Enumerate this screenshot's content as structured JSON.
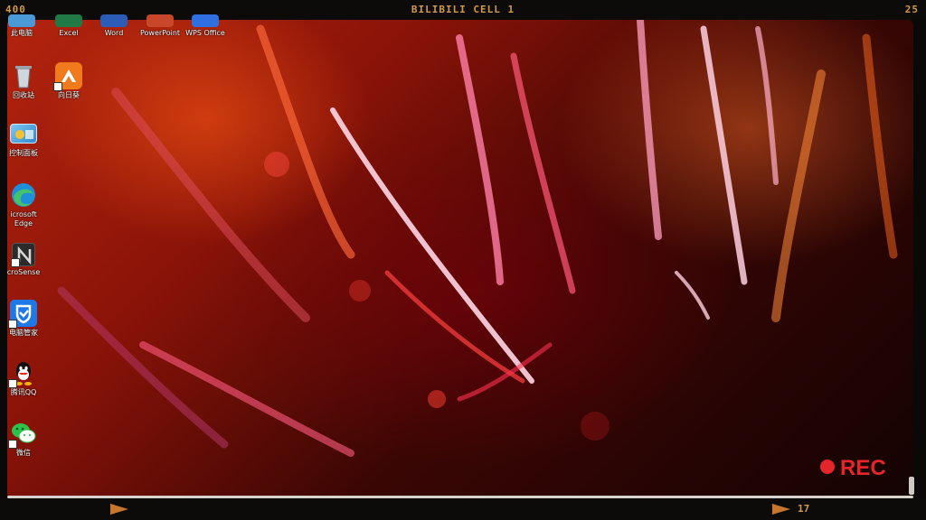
{
  "frame": {
    "top_left": "400",
    "top_center": "BILIBILI CELL 1",
    "top_right": "25",
    "bottom_right_number": "17",
    "rec_label": "REC"
  },
  "desktop_icons": {
    "top_row": [
      {
        "label": "此电脑",
        "icon": "this-pc-icon"
      },
      {
        "label": "Excel",
        "icon": "excel-icon"
      },
      {
        "label": "Word",
        "icon": "word-icon"
      },
      {
        "label": "PowerPoint",
        "icon": "powerpoint-icon"
      },
      {
        "label": "WPS Office",
        "icon": "wps-office-icon"
      }
    ],
    "column": [
      {
        "label": "回收站",
        "icon": "recycle-bin-icon"
      },
      {
        "label": "向日葵",
        "icon": "sunlogin-icon"
      },
      {
        "label": "控制面板",
        "icon": "control-panel-icon"
      },
      {
        "label": "icrosoft\nEdge",
        "icon": "edge-icon"
      },
      {
        "label": "croSense",
        "icon": "microsense-icon"
      },
      {
        "label": "电脑管家",
        "icon": "pc-manager-icon"
      },
      {
        "label": "腾讯QQ",
        "icon": "qq-icon"
      },
      {
        "label": "微信",
        "icon": "wechat-icon"
      }
    ]
  },
  "colors": {
    "frame_text": "#d19a4a",
    "rec_red": "#e4262a",
    "wallpaper_base": "#8a1308"
  }
}
